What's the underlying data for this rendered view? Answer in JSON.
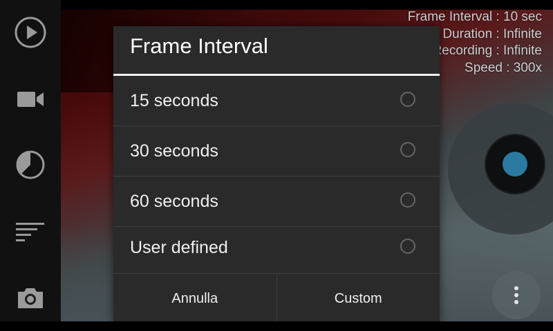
{
  "sidebar": {
    "items": [
      {
        "icon": "play-icon"
      },
      {
        "icon": "video-camera-icon"
      },
      {
        "icon": "timer-pie-icon"
      },
      {
        "icon": "filter-lines-icon"
      },
      {
        "icon": "photo-camera-icon"
      }
    ]
  },
  "info": {
    "line1": "Frame Interval : 10 sec",
    "line2": "Duration : Infinite",
    "line3": "Recording : Infinite",
    "line4": "Speed : 300x"
  },
  "dialog": {
    "title": "Frame Interval",
    "options": [
      {
        "label": "15 seconds",
        "selected": false
      },
      {
        "label": "30 seconds",
        "selected": false
      },
      {
        "label": "60 seconds",
        "selected": false
      },
      {
        "label": "User defined",
        "selected": false
      }
    ],
    "cancel_label": "Annulla",
    "custom_label": "Custom"
  },
  "colors": {
    "dialog_bg": "#2a2a2a",
    "accent_shutter": "#2b7aa1",
    "text_primary": "#f0f0f0"
  }
}
